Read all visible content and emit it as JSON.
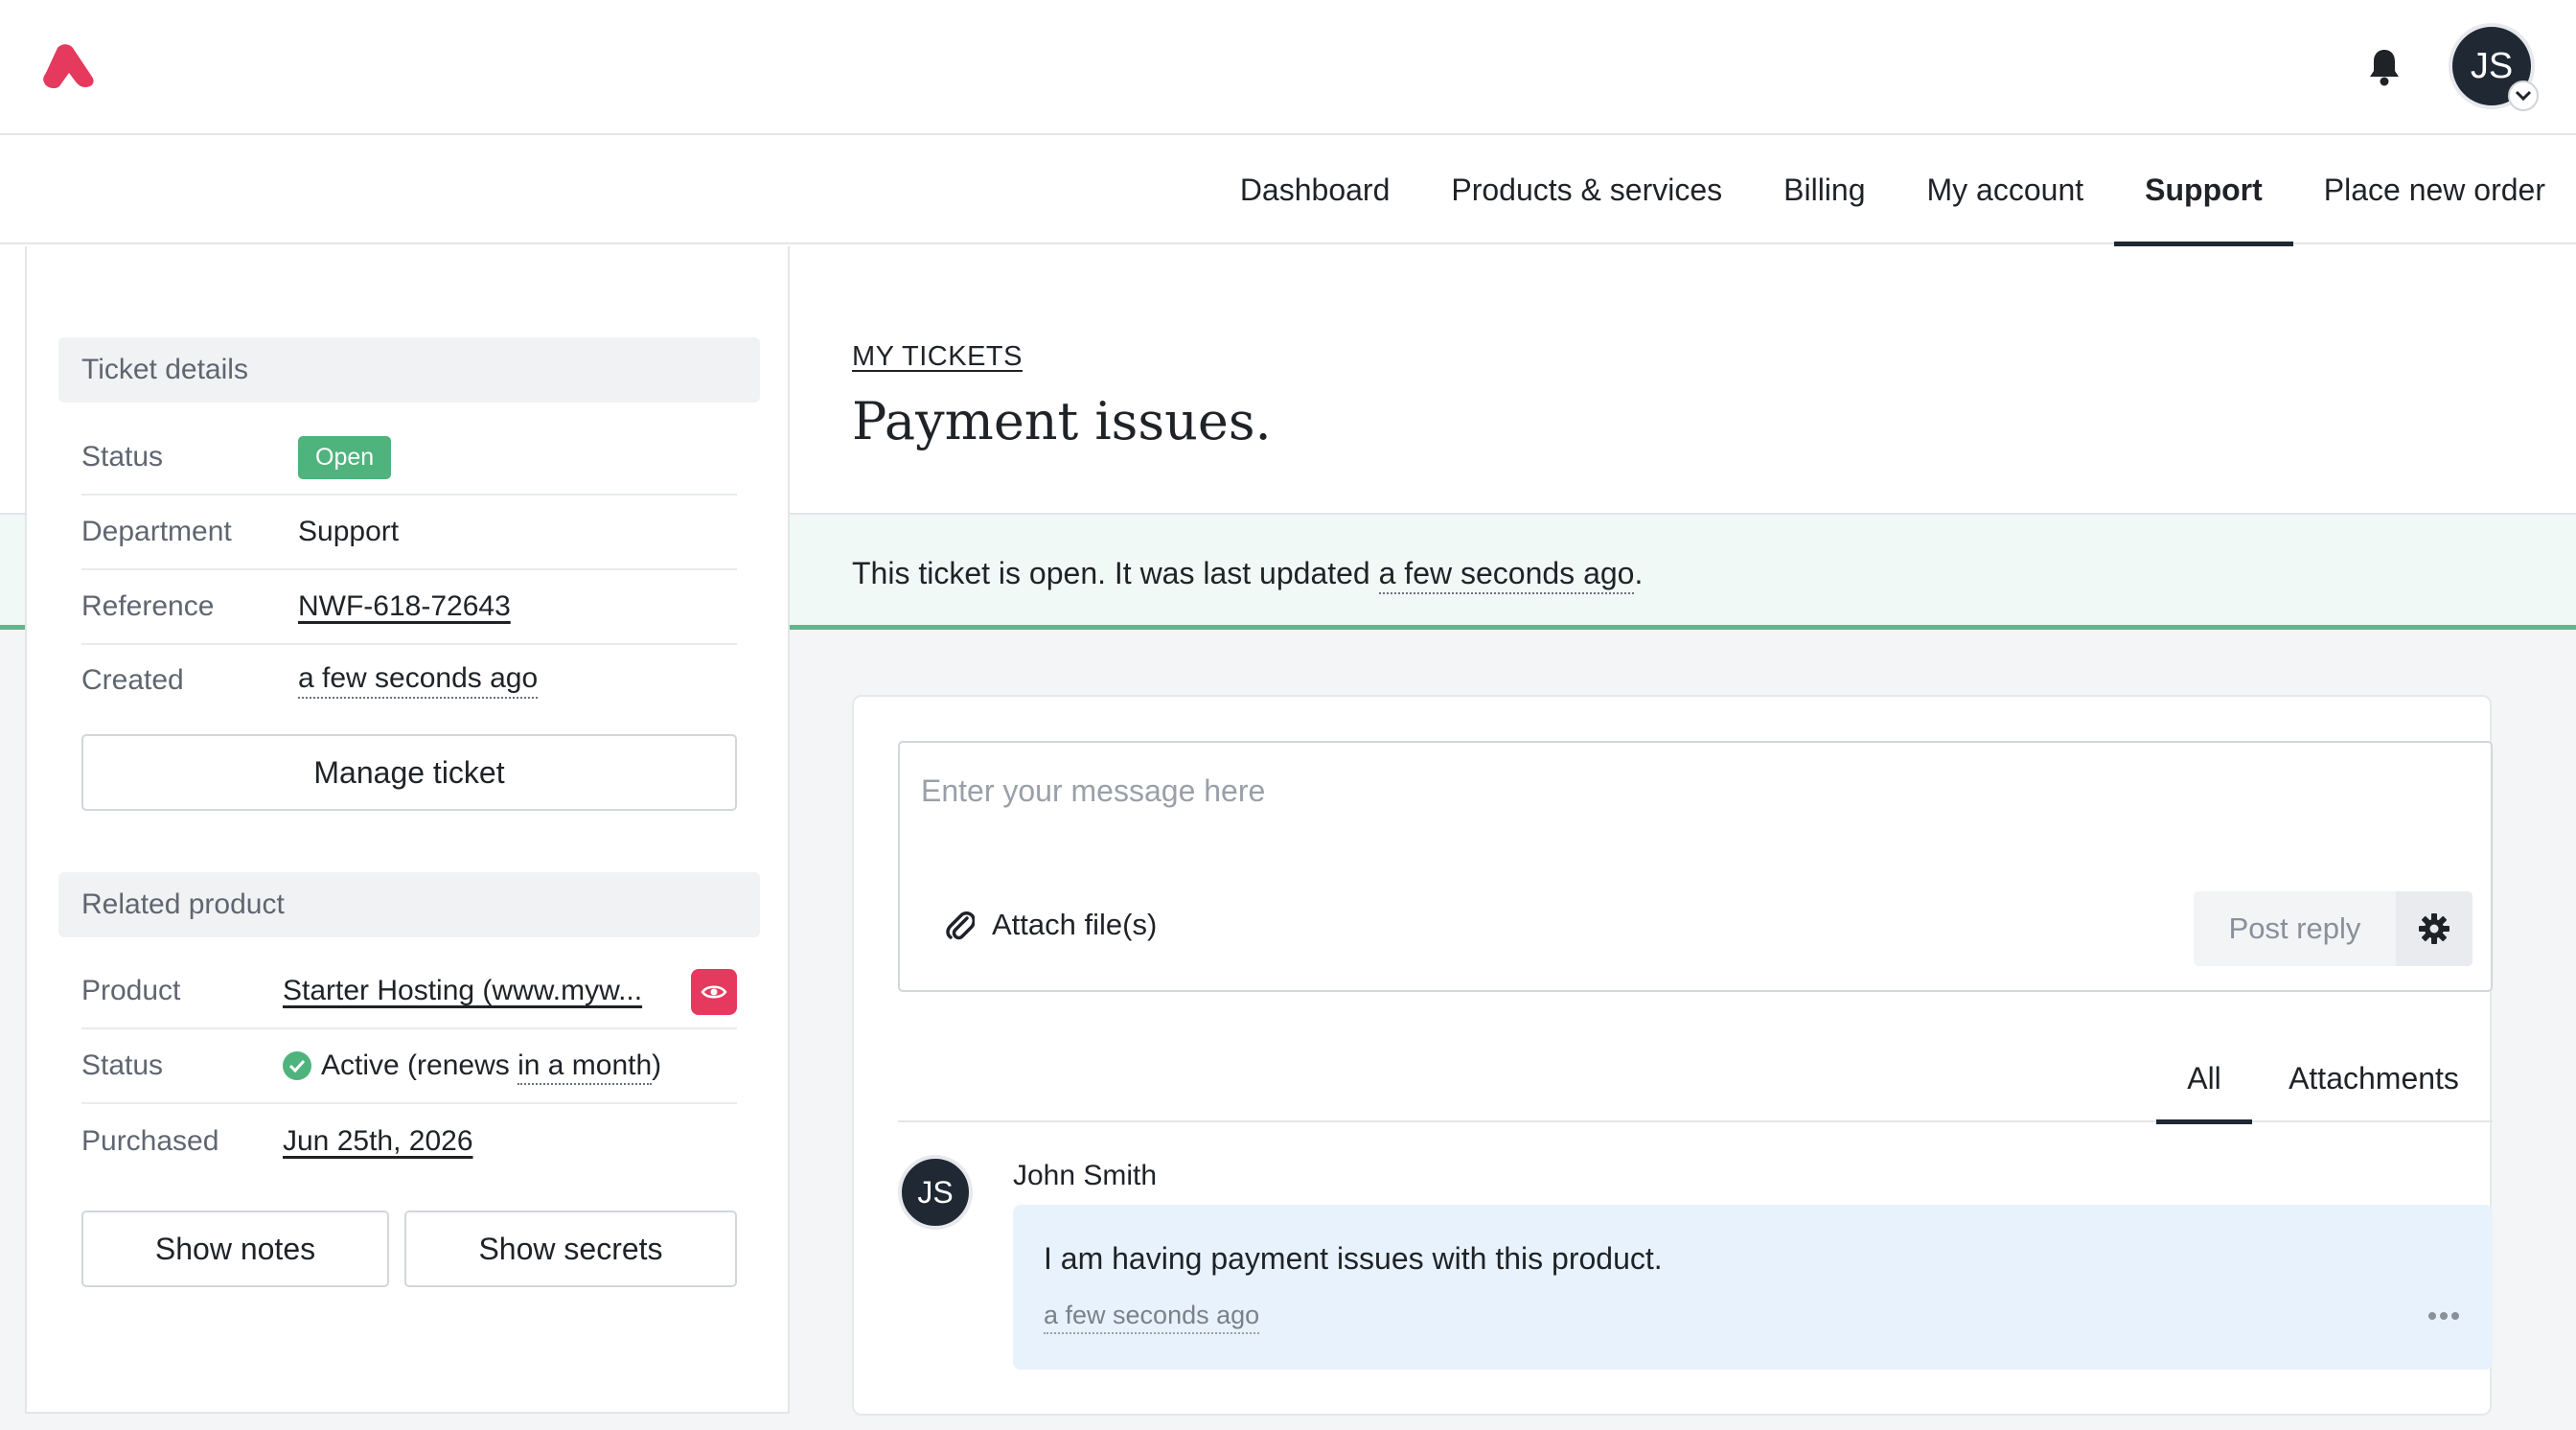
{
  "header": {
    "avatar_initials": "JS",
    "icons": {
      "logo": "brand-logo-icon",
      "notifications": "bell-icon",
      "account_menu": "chevron-down-icon"
    }
  },
  "nav": {
    "items": [
      {
        "label": "Dashboard",
        "active": false
      },
      {
        "label": "Products & services",
        "active": false
      },
      {
        "label": "Billing",
        "active": false
      },
      {
        "label": "My account",
        "active": false
      },
      {
        "label": "Support",
        "active": true
      },
      {
        "label": "Place new order",
        "active": false
      }
    ]
  },
  "ticket_details": {
    "heading": "Ticket details",
    "status_label": "Status",
    "status_value": "Open",
    "department_label": "Department",
    "department_value": "Support",
    "reference_label": "Reference",
    "reference_value": "NWF-618-72643",
    "created_label": "Created",
    "created_value": "a few seconds ago",
    "manage_button": "Manage ticket"
  },
  "related_product": {
    "heading": "Related product",
    "product_label": "Product",
    "product_value": "Starter Hosting (www.myw...",
    "status_label": "Status",
    "status_prefix": "Active (renews ",
    "status_relative": "in a month",
    "status_suffix": ")",
    "purchased_label": "Purchased",
    "purchased_value": "Jun 25th, 2026",
    "show_notes_button": "Show notes",
    "show_secrets_button": "Show secrets"
  },
  "page": {
    "breadcrumb": "MY TICKETS",
    "title": "Payment issues.",
    "status_prefix": "This ticket is open. It was last updated ",
    "status_relative": "a few seconds ago",
    "status_suffix": "."
  },
  "composer": {
    "placeholder": "Enter your message here",
    "attach_label": "Attach file(s)",
    "post_reply_label": "Post reply"
  },
  "tabs": [
    {
      "label": "All",
      "active": true
    },
    {
      "label": "Attachments",
      "active": false
    }
  ],
  "messages": [
    {
      "avatar_initials": "JS",
      "author": "John Smith",
      "text": "I am having payment issues with this product.",
      "time": "a few seconds ago"
    }
  ],
  "colors": {
    "brand": "#e5395d",
    "open_badge": "#4fb37e",
    "status_band": "#f1f9f6",
    "status_border": "#5cb98a",
    "message_bubble": "#e8f2fc",
    "dark": "#1f2833"
  }
}
